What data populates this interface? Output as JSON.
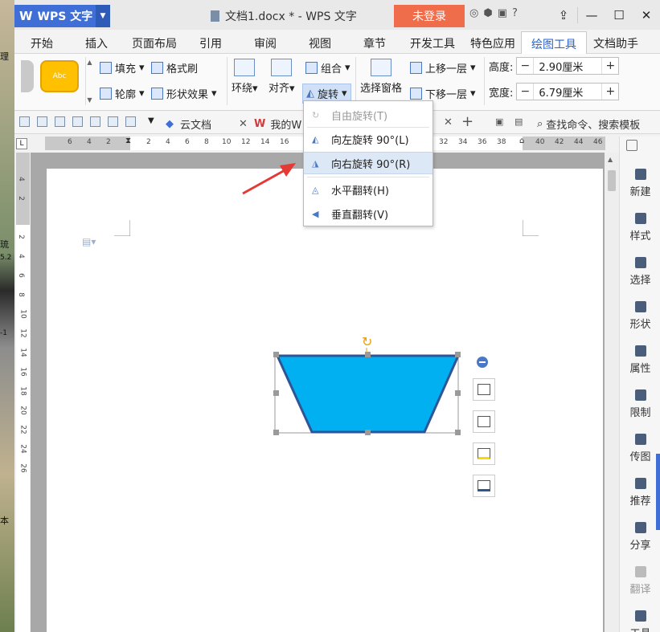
{
  "title_bar": {
    "app_name": "WPS 文字",
    "doc_title": "文档1.docx * - WPS 文字",
    "login_label": "未登录"
  },
  "ribbon_tabs": [
    {
      "label": "开始"
    },
    {
      "label": "插入"
    },
    {
      "label": "页面布局"
    },
    {
      "label": "引用"
    },
    {
      "label": "审阅"
    },
    {
      "label": "视图"
    },
    {
      "label": "章节"
    },
    {
      "label": "开发工具"
    },
    {
      "label": "特色应用"
    },
    {
      "label": "绘图工具",
      "active": true
    },
    {
      "label": "文档助手"
    }
  ],
  "ribbon": {
    "style_preview": "Abc",
    "fill": "填充",
    "format_painter": "格式刷",
    "outline": "轮廓",
    "shape_effect": "形状效果",
    "wrap": "环绕",
    "align": "对齐",
    "group": "组合",
    "rotate": "旋转",
    "selection_pane": "选择窗格",
    "bring_forward": "上移一层",
    "send_backward": "下移一层",
    "height_label": "高度:",
    "height_value": "2.90厘米",
    "width_label": "宽度:",
    "width_value": "6.79厘米"
  },
  "doc_tabs": [
    {
      "label": "云文档"
    },
    {
      "label": "我的W"
    }
  ],
  "search_label": "查找命令、搜索模板",
  "rotate_menu": {
    "items": [
      {
        "label": "自由旋转(T)",
        "disabled": true
      },
      {
        "label": "向左旋转 90°(L)"
      },
      {
        "label": "向右旋转 90°(R)",
        "highlighted": true
      },
      {
        "label": "水平翻转(H)"
      },
      {
        "label": "垂直翻转(V)"
      }
    ]
  },
  "ruler": {
    "h_numbers": [
      "6",
      "4",
      "2",
      "2",
      "4",
      "6",
      "8",
      "10",
      "12",
      "14",
      "16",
      "32",
      "34",
      "36",
      "38",
      "40",
      "42",
      "44",
      "46"
    ],
    "v_numbers": [
      "4",
      "2",
      "2",
      "4",
      "6",
      "8",
      "10",
      "12",
      "14",
      "16",
      "18",
      "20",
      "22",
      "24",
      "26"
    ]
  },
  "right_panel": [
    {
      "label": "新建"
    },
    {
      "label": "样式"
    },
    {
      "label": "选择"
    },
    {
      "label": "形状"
    },
    {
      "label": "属性"
    },
    {
      "label": "限制"
    },
    {
      "label": "传图"
    },
    {
      "label": "推荐"
    },
    {
      "label": "分享"
    },
    {
      "label": "翻译",
      "disabled": true
    },
    {
      "label": "工具"
    }
  ],
  "shape": {
    "type": "trapezoid",
    "fill": "#00b0f0",
    "outline": "#2f5597"
  },
  "colors": {
    "accent": "#2a63c9",
    "login": "#f06d4c",
    "wps_blue": "#3f6fd6",
    "arrow": "#e53935"
  },
  "desktop_labels": [
    "理",
    "琉",
    "5.2",
    "-1",
    "本"
  ]
}
